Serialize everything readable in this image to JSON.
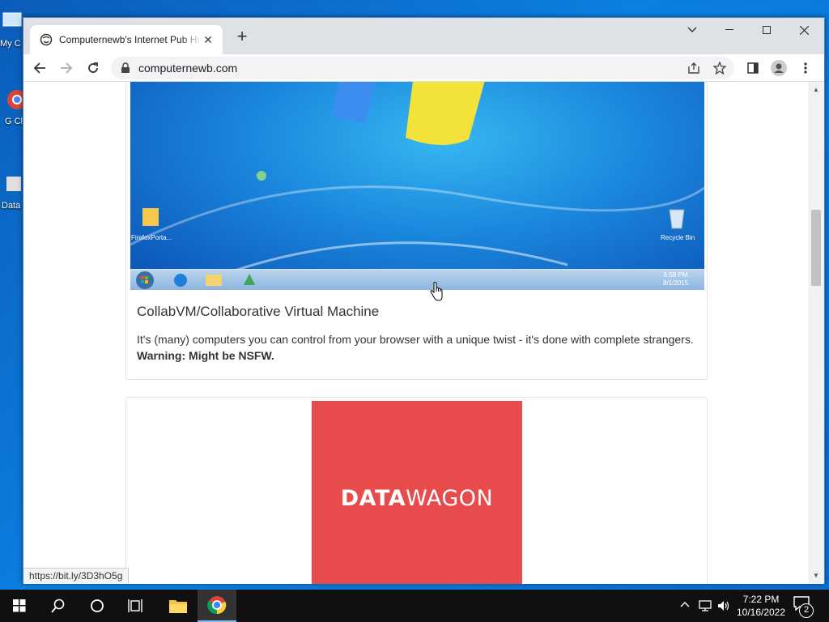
{
  "desktop": {
    "icons": [
      {
        "label": "My C"
      },
      {
        "label": "G Cl"
      },
      {
        "label": "Data"
      }
    ]
  },
  "browser": {
    "tab_title": "Computernewb's Internet Pub Hub",
    "url": "computernewb.com",
    "status_url": "https://bit.ly/3D3hO5g"
  },
  "page": {
    "card1": {
      "screenshot": {
        "icon_left_label": "FirefoxPorta...",
        "icon_right_label": "Recycle Bin",
        "clock_time": "6:58 PM",
        "clock_date": "8/1/2015"
      },
      "title": "CollabVM/Collaborative Virtual Machine",
      "text": "It's (many) computers you can control from your browser with a unique twist - it's done with complete strangers.",
      "warning": "Warning: Might be NSFW."
    },
    "card2": {
      "logo_bold": "DATA",
      "logo_light": "WAGON"
    }
  },
  "taskbar": {
    "time": "7:22 PM",
    "date": "10/16/2022",
    "notification_count": "2"
  },
  "colors": {
    "logo_bg": "#e74b4b",
    "win_accent": "#0a78d4"
  }
}
